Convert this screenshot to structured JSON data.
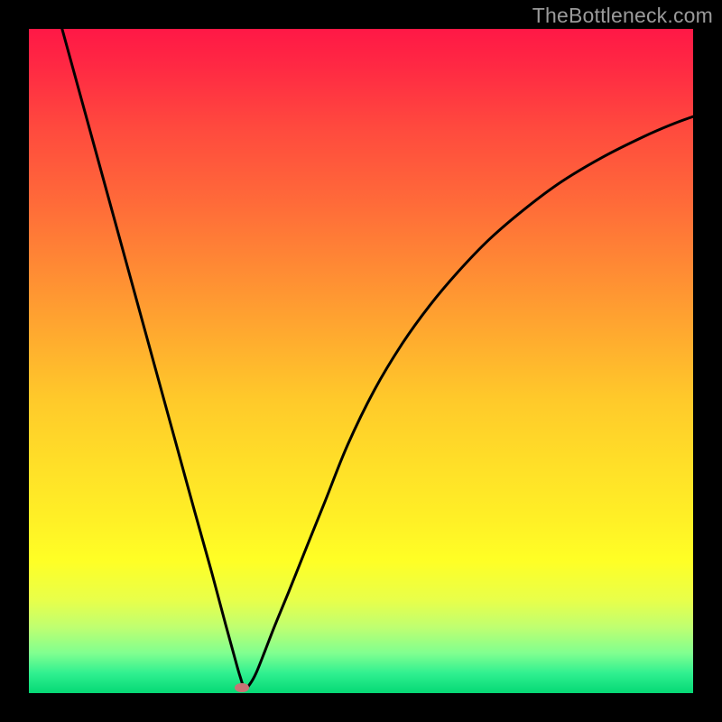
{
  "watermark": "TheBottleneck.com",
  "colors": {
    "frame": "#000000",
    "curve": "#000000",
    "marker": "#c97375"
  },
  "chart_data": {
    "type": "line",
    "title": "",
    "xlabel": "",
    "ylabel": "",
    "xlim": [
      0,
      100
    ],
    "ylim": [
      0,
      100
    ],
    "grid": false,
    "series": [
      {
        "name": "bottleneck-curve",
        "comment": "V-shaped curve; x in percent of horizontal range, y = distance from top (0=top, 100=bottom). Minimum (optimum) at x≈32.",
        "x": [
          5.0,
          7.5,
          10.0,
          12.5,
          15.0,
          17.5,
          20.0,
          22.5,
          25.0,
          27.6,
          29.6,
          31.0,
          31.8,
          32.5,
          33.3,
          34.2,
          35.6,
          37.0,
          39.1,
          41.9,
          44.6,
          48.0,
          52.0,
          56.2,
          60.3,
          64.5,
          69.3,
          74.8,
          80.2,
          86.4,
          92.6,
          97.0,
          100.0
        ],
        "y": [
          0.0,
          9.1,
          18.2,
          27.3,
          36.4,
          45.5,
          54.6,
          63.7,
          72.8,
          82.1,
          89.6,
          94.7,
          97.5,
          99.3,
          98.6,
          97.0,
          93.5,
          89.9,
          84.8,
          77.8,
          71.1,
          62.6,
          54.4,
          47.4,
          41.7,
          36.7,
          31.7,
          27.0,
          23.0,
          19.3,
          16.2,
          14.3,
          13.2
        ]
      }
    ],
    "annotations": [
      {
        "type": "marker",
        "x": 32.1,
        "y": 99.2
      }
    ]
  }
}
